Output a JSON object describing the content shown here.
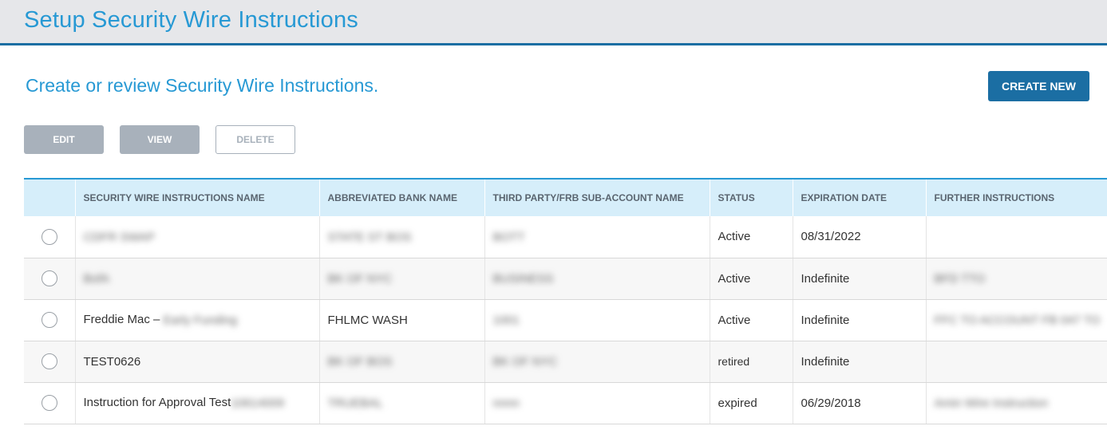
{
  "header": {
    "title": "Setup Security Wire Instructions"
  },
  "subtitle": "Create or review Security Wire Instructions.",
  "toolbar": {
    "create_label": "CREATE NEW",
    "edit_label": "EDIT",
    "view_label": "VIEW",
    "delete_label": "DELETE"
  },
  "table": {
    "columns": [
      "SECURITY WIRE INSTRUCTIONS NAME",
      "ABBREVIATED BANK NAME",
      "THIRD PARTY/FRB SUB-ACCOUNT NAME",
      "STATUS",
      "EXPIRATION DATE",
      "FURTHER INSTRUCTIONS"
    ],
    "rows": [
      {
        "name": "",
        "name_redacted": "CDFR SWAP",
        "bank": "STATE ST BOS",
        "third_party": "BOTT",
        "status": "Active",
        "expiration": "08/31/2022",
        "further": ""
      },
      {
        "name": "",
        "name_redacted": "BofA",
        "bank": "BK OF NYC",
        "third_party": "BUSINESS",
        "status": "Active",
        "expiration": "Indefinite",
        "further": "BFD TTO"
      },
      {
        "name": "Freddie Mac –",
        "name_redacted": "Early Funding",
        "bank": "FHLMC WASH",
        "third_party": "1001",
        "status": "Active",
        "expiration": "Indefinite",
        "further": "FFC TO ACCOUNT FB 047 TO"
      },
      {
        "name": "TEST0626",
        "name_redacted": "",
        "bank": "BK OF BOS",
        "third_party": "BK OF NYC",
        "status": "retired",
        "expiration": "Indefinite",
        "further": ""
      },
      {
        "name": "Instruction for Approval Test",
        "name_redacted": "10614009",
        "bank": "TRUEBAL",
        "third_party": "nnnn",
        "status": "expired",
        "expiration": "06/29/2018",
        "further": "Amin Wire Instruction"
      }
    ]
  }
}
